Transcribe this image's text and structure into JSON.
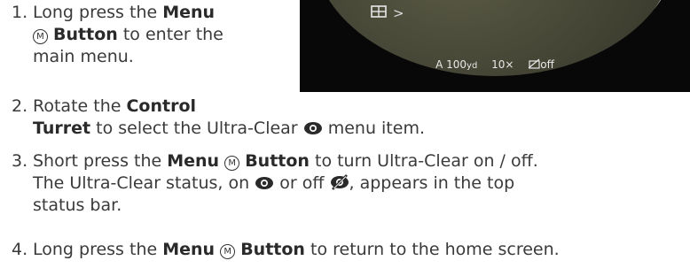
{
  "steps": [
    {
      "number": "1.",
      "line1_pre": "Long press the ",
      "line1_bold": "Menu",
      "menu_icon_letter": "M",
      "line2_bold": "Button",
      "line2_post": " to enter the",
      "line3": "main menu."
    },
    {
      "number": "2.",
      "line1_pre": "Rotate the ",
      "line1_bold": "Control",
      "line2_bold": "Turret",
      "line2_post": " to select the Ultra-Clear",
      "line2_end": " menu item.",
      "icon": "eye-icon"
    },
    {
      "number": "3.",
      "line1_pre": "Short press the ",
      "line1_bold": "Menu",
      "menu_icon_letter": "M",
      "line1_bold2": "Button",
      "line1_post": " to turn Ultra-Clear on / off.",
      "line2_a": "The Ultra-Clear status, on ",
      "line2_b": " or off ",
      "line2_c": ", appears in the top",
      "line3": "status bar.",
      "icons": [
        "eye-icon",
        "eye-off-icon"
      ]
    },
    {
      "number": "4.",
      "line1_pre": "Long press the ",
      "line1_bold": "Menu",
      "menu_icon_letter": "M",
      "line1_bold2": "Button",
      "line1_post": " to return to the home screen."
    }
  ],
  "device_screen": {
    "chevron": ">",
    "status_mode": "A",
    "status_range": "100",
    "status_range_unit": "yd",
    "status_zoom": "10×",
    "status_ultraclear": "off",
    "icons": [
      "grid-icon",
      "ultraclear-off-icon"
    ]
  }
}
